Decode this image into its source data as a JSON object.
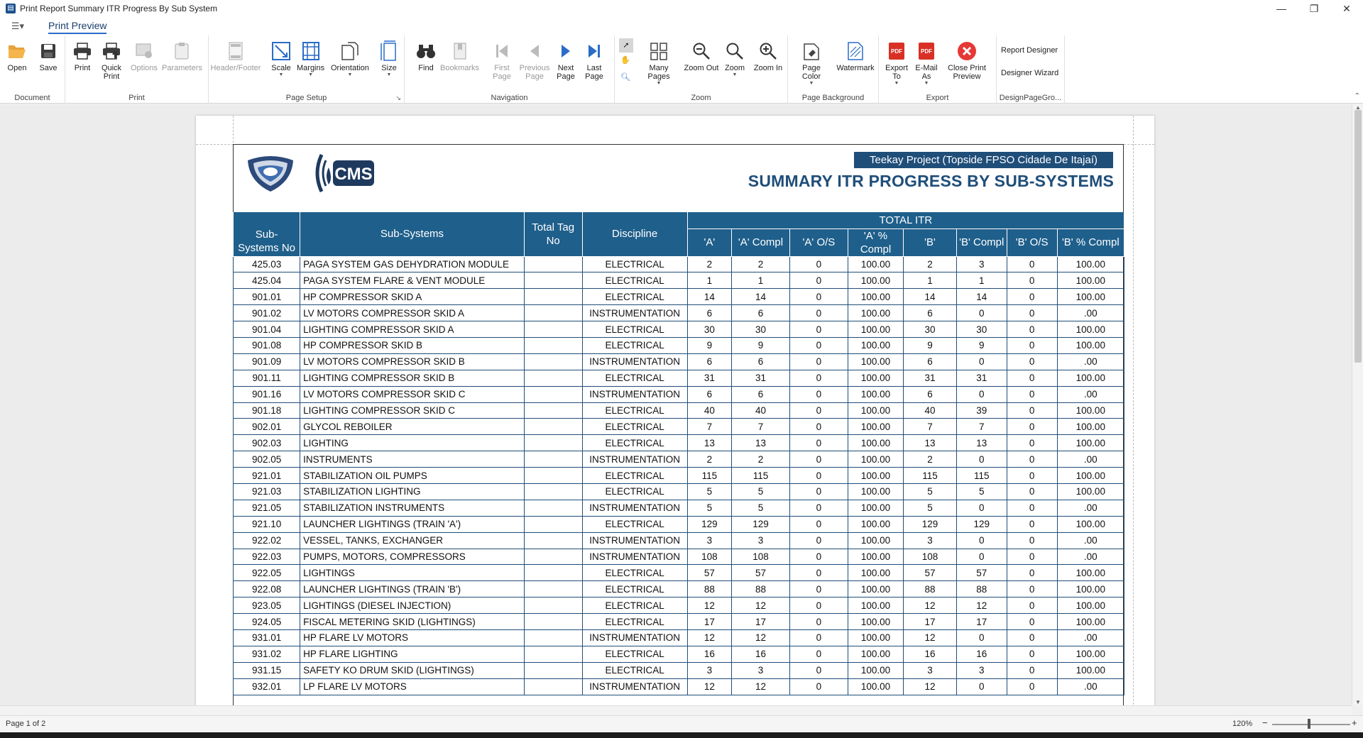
{
  "window": {
    "title": "Print Report Summary ITR Progress By Sub System",
    "minimize": "—",
    "restore": "❐",
    "close": "✕"
  },
  "ribbon_tab": "Print Preview",
  "ribbon": {
    "document": {
      "label": "Document",
      "open": "Open",
      "save": "Save"
    },
    "print": {
      "label": "Print",
      "print": "Print",
      "quick_print": "Quick Print",
      "options": "Options",
      "parameters": "Parameters"
    },
    "page_setup": {
      "label": "Page Setup",
      "header_footer": "Header/Footer",
      "scale": "Scale",
      "margins": "Margins",
      "orientation": "Orientation",
      "size": "Size"
    },
    "navigation": {
      "label": "Navigation",
      "find": "Find",
      "bookmarks": "Bookmarks",
      "first_page": "First Page",
      "previous_page": "Previous Page",
      "next_page": "Next Page",
      "last_page": "Last Page"
    },
    "zoom": {
      "label": "Zoom",
      "many_pages": "Many Pages",
      "zoom_out": "Zoom Out",
      "zoom": "Zoom",
      "zoom_in": "Zoom In"
    },
    "page_background": {
      "label": "Page Background",
      "page_color": "Page Color",
      "watermark": "Watermark"
    },
    "export": {
      "label": "Export",
      "export_to": "Export To",
      "email_as": "E-Mail As",
      "close_preview": "Close Print Preview"
    },
    "design": {
      "label": "DesignPageGro...",
      "report_designer": "Report Designer",
      "designer_wizard": "Designer Wizard"
    }
  },
  "report": {
    "project": "Teekay Project (Topside FPSO Cidade De Itajaí)",
    "title": "SUMMARY ITR PROGRESS BY SUB-SYSTEMS",
    "logo_text": "CMS",
    "group_header": "TOTAL ITR",
    "columns": [
      "Sub-Systems No",
      "Sub-Systems",
      "Total Tag No",
      "Discipline",
      "'A'",
      "'A' Compl",
      "'A' O/S",
      "'A' % Compl",
      "'B'",
      "'B' Compl",
      "'B' O/S",
      "'B' % Compl"
    ],
    "rows": [
      [
        "425.03",
        "PAGA SYSTEM GAS DEHYDRATION MODULE",
        "",
        "ELECTRICAL",
        "2",
        "2",
        "0",
        "100.00",
        "2",
        "3",
        "0",
        "100.00"
      ],
      [
        "425.04",
        "PAGA SYSTEM FLARE & VENT MODULE",
        "",
        "ELECTRICAL",
        "1",
        "1",
        "0",
        "100.00",
        "1",
        "1",
        "0",
        "100.00"
      ],
      [
        "901.01",
        "HP COMPRESSOR SKID A",
        "",
        "ELECTRICAL",
        "14",
        "14",
        "0",
        "100.00",
        "14",
        "14",
        "0",
        "100.00"
      ],
      [
        "901.02",
        "LV MOTORS COMPRESSOR SKID A",
        "",
        "INSTRUMENTATION",
        "6",
        "6",
        "0",
        "100.00",
        "6",
        "0",
        "0",
        ".00"
      ],
      [
        "901.04",
        "LIGHTING COMPRESSOR SKID A",
        "",
        "ELECTRICAL",
        "30",
        "30",
        "0",
        "100.00",
        "30",
        "30",
        "0",
        "100.00"
      ],
      [
        "901.08",
        "HP COMPRESSOR SKID B",
        "",
        "ELECTRICAL",
        "9",
        "9",
        "0",
        "100.00",
        "9",
        "9",
        "0",
        "100.00"
      ],
      [
        "901.09",
        "LV MOTORS COMPRESSOR SKID B",
        "",
        "INSTRUMENTATION",
        "6",
        "6",
        "0",
        "100.00",
        "6",
        "0",
        "0",
        ".00"
      ],
      [
        "901.11",
        "LIGHTING COMPRESSOR SKID B",
        "",
        "ELECTRICAL",
        "31",
        "31",
        "0",
        "100.00",
        "31",
        "31",
        "0",
        "100.00"
      ],
      [
        "901.16",
        "LV MOTORS COMPRESSOR SKID C",
        "",
        "INSTRUMENTATION",
        "6",
        "6",
        "0",
        "100.00",
        "6",
        "0",
        "0",
        ".00"
      ],
      [
        "901.18",
        "LIGHTING COMPRESSOR SKID C",
        "",
        "ELECTRICAL",
        "40",
        "40",
        "0",
        "100.00",
        "40",
        "39",
        "0",
        "100.00"
      ],
      [
        "902.01",
        "GLYCOL REBOILER",
        "",
        "ELECTRICAL",
        "7",
        "7",
        "0",
        "100.00",
        "7",
        "7",
        "0",
        "100.00"
      ],
      [
        "902.03",
        "LIGHTING",
        "",
        "ELECTRICAL",
        "13",
        "13",
        "0",
        "100.00",
        "13",
        "13",
        "0",
        "100.00"
      ],
      [
        "902.05",
        "INSTRUMENTS",
        "",
        "INSTRUMENTATION",
        "2",
        "2",
        "0",
        "100.00",
        "2",
        "0",
        "0",
        ".00"
      ],
      [
        "921.01",
        "STABILIZATION OIL PUMPS",
        "",
        "ELECTRICAL",
        "115",
        "115",
        "0",
        "100.00",
        "115",
        "115",
        "0",
        "100.00"
      ],
      [
        "921.03",
        "STABILIZATION LIGHTING",
        "",
        "ELECTRICAL",
        "5",
        "5",
        "0",
        "100.00",
        "5",
        "5",
        "0",
        "100.00"
      ],
      [
        "921.05",
        "STABILIZATION INSTRUMENTS",
        "",
        "INSTRUMENTATION",
        "5",
        "5",
        "0",
        "100.00",
        "5",
        "0",
        "0",
        ".00"
      ],
      [
        "921.10",
        "LAUNCHER LIGHTINGS (TRAIN 'A')",
        "",
        "ELECTRICAL",
        "129",
        "129",
        "0",
        "100.00",
        "129",
        "129",
        "0",
        "100.00"
      ],
      [
        "922.02",
        "VESSEL, TANKS, EXCHANGER",
        "",
        "INSTRUMENTATION",
        "3",
        "3",
        "0",
        "100.00",
        "3",
        "0",
        "0",
        ".00"
      ],
      [
        "922.03",
        "PUMPS, MOTORS, COMPRESSORS",
        "",
        "INSTRUMENTATION",
        "108",
        "108",
        "0",
        "100.00",
        "108",
        "0",
        "0",
        ".00"
      ],
      [
        "922.05",
        "LIGHTINGS",
        "",
        "ELECTRICAL",
        "57",
        "57",
        "0",
        "100.00",
        "57",
        "57",
        "0",
        "100.00"
      ],
      [
        "922.08",
        "LAUNCHER LIGHTINGS (TRAIN 'B')",
        "",
        "ELECTRICAL",
        "88",
        "88",
        "0",
        "100.00",
        "88",
        "88",
        "0",
        "100.00"
      ],
      [
        "923.05",
        "LIGHTINGS (DIESEL INJECTION)",
        "",
        "ELECTRICAL",
        "12",
        "12",
        "0",
        "100.00",
        "12",
        "12",
        "0",
        "100.00"
      ],
      [
        "924.05",
        "FISCAL METERING SKID (LIGHTINGS)",
        "",
        "ELECTRICAL",
        "17",
        "17",
        "0",
        "100.00",
        "17",
        "17",
        "0",
        "100.00"
      ],
      [
        "931.01",
        "HP FLARE LV MOTORS",
        "",
        "INSTRUMENTATION",
        "12",
        "12",
        "0",
        "100.00",
        "12",
        "0",
        "0",
        ".00"
      ],
      [
        "931.02",
        "HP FLARE LIGHTING",
        "",
        "ELECTRICAL",
        "16",
        "16",
        "0",
        "100.00",
        "16",
        "16",
        "0",
        "100.00"
      ],
      [
        "931.15",
        "SAFETY KO DRUM SKID (LIGHTINGS)",
        "",
        "ELECTRICAL",
        "3",
        "3",
        "0",
        "100.00",
        "3",
        "3",
        "0",
        "100.00"
      ],
      [
        "932.01",
        "LP FLARE LV MOTORS",
        "",
        "INSTRUMENTATION",
        "12",
        "12",
        "0",
        "100.00",
        "12",
        "0",
        "0",
        ".00"
      ]
    ]
  },
  "statusbar": {
    "page_info": "Page 1 of 2",
    "zoom": "120%",
    "zoom_minus": "−",
    "zoom_plus": "+"
  },
  "colors": {
    "header_blue": "#1f5f8b",
    "title_blue": "#1f4e79",
    "accent": "#2a6cc8"
  }
}
